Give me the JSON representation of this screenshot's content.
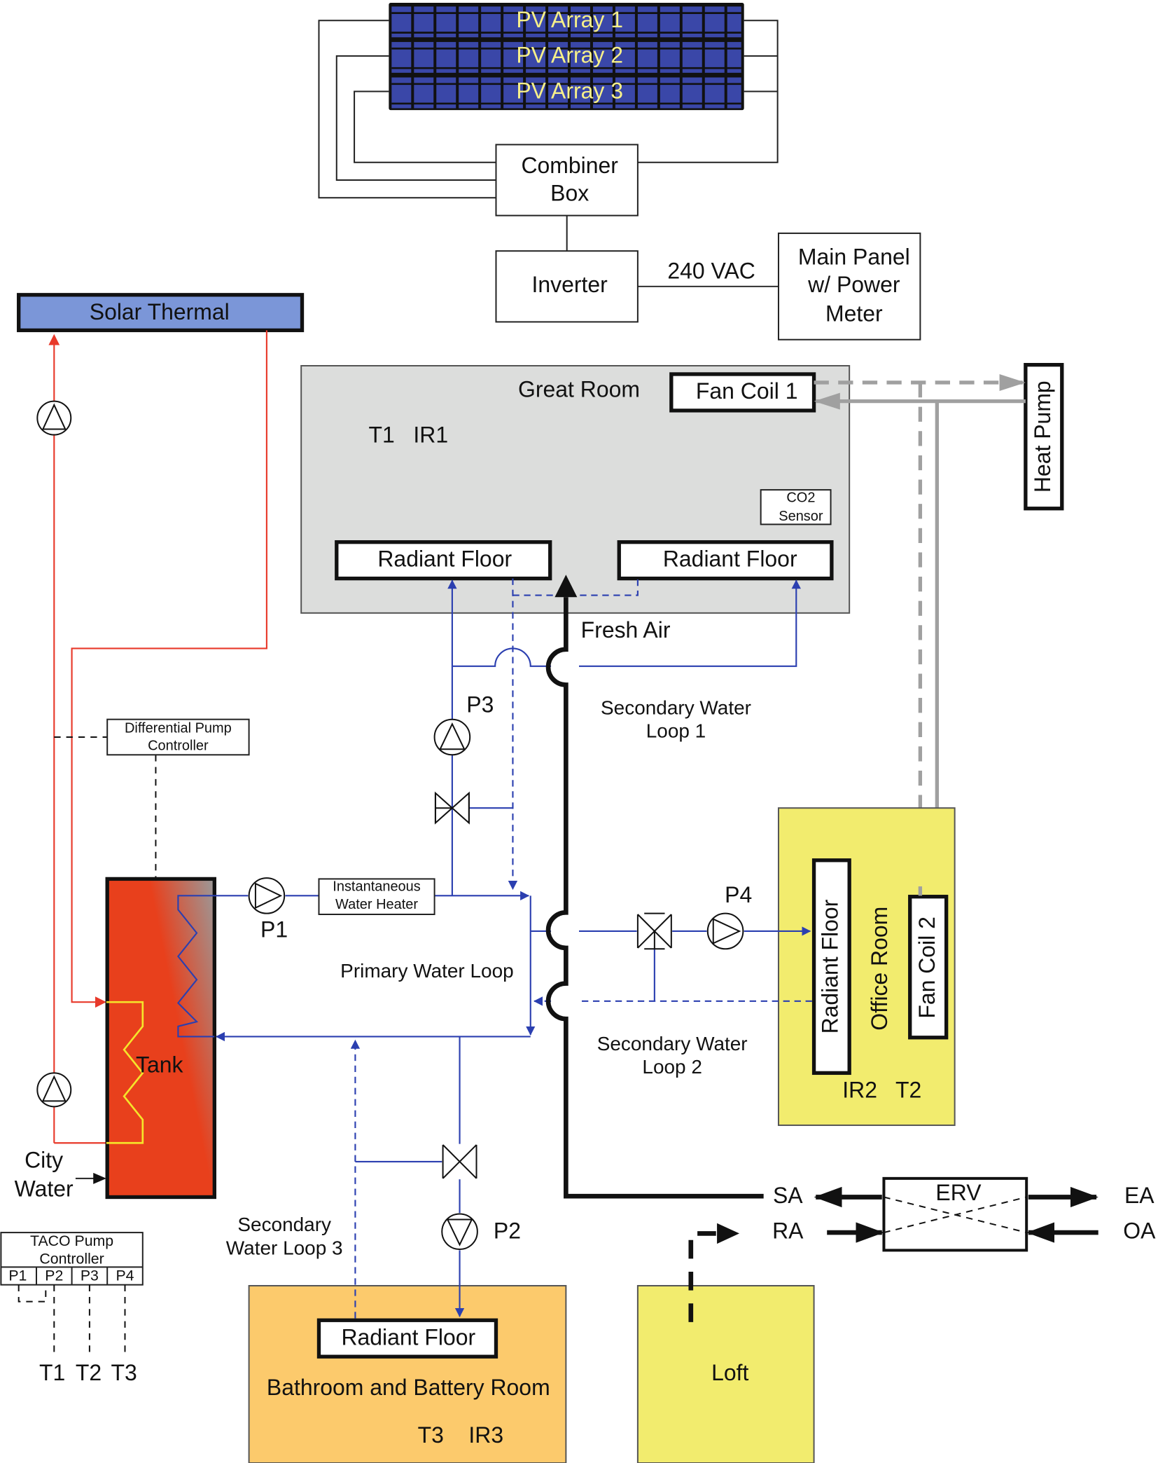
{
  "colors": {
    "pv_panel": "#3a47a8",
    "pv_text": "#f7f08a",
    "solar_thermal": "#7b96d8",
    "great_room": "#dcdddc",
    "office_room": "#f2ec6e",
    "loft": "#f2ec6e",
    "bathroom": "#fcca6c",
    "tank_hot": "#e8401c",
    "tank_cool": "#9a9a9a",
    "hot_water_line": "#e8392a",
    "water_loop_line": "#2b3fb0",
    "heat_pump_line": "#a0a0a0",
    "tank_coil": "#f5e42a"
  },
  "pv": {
    "array1": "PV Array 1",
    "array2": "PV Array 2",
    "array3": "PV Array 3"
  },
  "combiner": {
    "line1": "Combiner",
    "line2": "Box"
  },
  "inverter": "Inverter",
  "vac": "240 VAC",
  "main_panel": {
    "line1": "Main Panel",
    "line2": "w/ Power",
    "line3": "Meter"
  },
  "solar_thermal": "Solar Thermal",
  "diff_controller": {
    "line1": "Differential Pump",
    "line2": "Controller"
  },
  "city_water": {
    "line1": "City",
    "line2": "Water"
  },
  "tank": "Tank",
  "taco": {
    "line1": "TACO Pump",
    "line2": "Controller",
    "ports": [
      "P1",
      "P2",
      "P3",
      "P4"
    ],
    "sensors": [
      "T1",
      "T2",
      "T3"
    ]
  },
  "great_room": {
    "title": "Great Room",
    "sensors": "T1   IR1",
    "fan_coil": "Fan Coil 1",
    "co2_line1": "CO2",
    "co2_line2": "Sensor",
    "radiant_left": "Radiant Floor",
    "radiant_right": "Radiant Floor"
  },
  "heat_pump": "Heat Pump",
  "fresh_air": "Fresh Air",
  "pumps": {
    "p1": "P1",
    "p2": "P2",
    "p3": "P3",
    "p4": "P4"
  },
  "loops": {
    "sec1_line1": "Secondary Water",
    "sec1_line2": "Loop 1",
    "primary": "Primary Water Loop",
    "sec2_line1": "Secondary Water",
    "sec2_line2": "Loop 2",
    "sec3_line1": "Secondary",
    "sec3_line2": "Water Loop 3"
  },
  "water_heater": {
    "line1": "Instantaneous",
    "line2": "Water Heater"
  },
  "office": {
    "title": "Office Room",
    "radiant": "Radiant Floor",
    "fan_coil": "Fan Coil 2",
    "sensors": "IR2   T2"
  },
  "bathroom": {
    "radiant": "Radiant Floor",
    "title": "Bathroom and Battery Room",
    "sensors": "T3    IR3"
  },
  "loft": "Loft",
  "erv": {
    "title": "ERV",
    "sa": "SA",
    "ra": "RA",
    "ea": "EA",
    "oa": "OA"
  }
}
